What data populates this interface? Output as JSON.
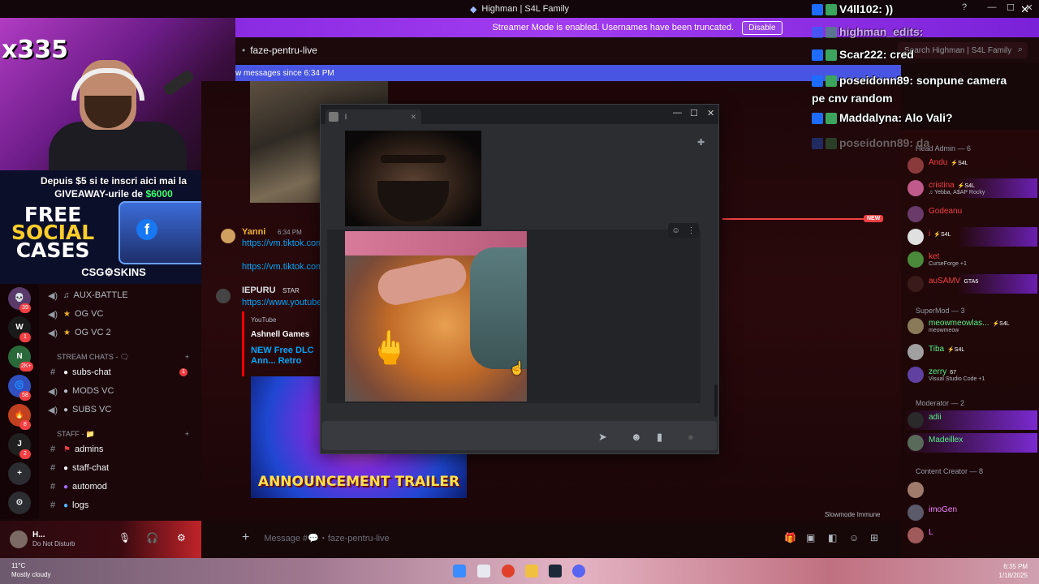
{
  "window": {
    "title": "Highman | S4L Family"
  },
  "streamer_bar": {
    "text": "Streamer Mode is enabled. Usernames have been truncated.",
    "button": "Disable"
  },
  "channel_header": {
    "name": "faze-pentru-live",
    "search_placeholder": "Search Highman | S4L Family"
  },
  "new_messages": {
    "text": "w messages since 6:34 PM"
  },
  "webcam": {
    "counter": "x335"
  },
  "promo": {
    "line1": "Depuis $5 si te inscri aici mai la",
    "line2_prefix": "GIVEAWAY-urile de ",
    "line2_amount": "$6000",
    "free": "FREE",
    "social": "SOCIAL",
    "cases": "CASES",
    "brand": "CSG⚙SKINS"
  },
  "servers": [
    {
      "label": "💀",
      "color": "#5a3a6a",
      "badge": "39"
    },
    {
      "label": "W",
      "color": "#1a1a1a",
      "badge": "1"
    },
    {
      "label": "N",
      "color": "#2a6a3a",
      "badge": "2K+"
    },
    {
      "label": "🌀",
      "color": "#3050c0",
      "badge": "58"
    },
    {
      "label": "🔥",
      "color": "#c04020",
      "badge": "8"
    },
    {
      "label": "J",
      "color": "#202020",
      "badge": "2"
    },
    {
      "label": "+",
      "color": "#2b2d31",
      "badge": ""
    },
    {
      "label": "⊙",
      "color": "#2b2d31",
      "badge": ""
    }
  ],
  "channels": {
    "aux_battle": "AUX-BATTLE",
    "og_vc": "OG VC",
    "og_vc_2": "OG VC 2",
    "stream_chats_cat": "STREAM CHATS - 🗨",
    "subs_chat": "subs-chat",
    "subs_chat_badge": "1",
    "mods_vc": "MODS VC",
    "subs_vc": "SUBS VC",
    "staff_cat": "STAFF - 📁",
    "admins": "admins",
    "staff_chat": "staff-chat",
    "automod": "automod",
    "logs": "logs"
  },
  "user_panel": {
    "name": "H...",
    "status": "Do Not Disturb"
  },
  "chat": {
    "msg1_name": "Yanni",
    "msg1_time": "6:34 PM",
    "msg1_link1": "https://vm.tiktok.com",
    "msg1_link2": "https://vm.tiktok.com",
    "msg2_name": "IEPURU",
    "msg2_tag": "STAR",
    "msg2_link": "https://www.youtube",
    "embed_provider": "YouTube",
    "embed_author": "Ashnell Games",
    "embed_title": "NEW Free DLC Ann... Retro",
    "trailer_text": "ANNOUNCEMENT TRAILER",
    "new_tag": "NEW",
    "composer_placeholder": "Message #💬・faze-pentru-live",
    "slowmode": "Slowmode Immune"
  },
  "popup": {
    "tab_title": "l"
  },
  "members": {
    "head_admin": "Head Admin — 6",
    "supermod": "SuperMod — 3",
    "moderator": "Moderator — 2",
    "content_creator": "Content Creator — 8",
    "rows": [
      {
        "name": "Andu",
        "tag": "⚡S4L",
        "sub": "",
        "color": "#f23f43"
      },
      {
        "name": "cristina",
        "tag": "⚡S4L",
        "sub": "♫ Yebba, A$AP Rocky",
        "color": "#f23f43"
      },
      {
        "name": "Godeanu",
        "tag": "",
        "sub": "",
        "color": "#f23f43"
      },
      {
        "name": "i",
        "tag": "⚡S4L",
        "sub": "",
        "color": "#f23f43"
      },
      {
        "name": "ket",
        "tag": "",
        "sub": "CurseForge +1",
        "color": "#f23f43"
      },
      {
        "name": "auSAMV",
        "tag": "GTA6",
        "sub": "",
        "color": "#f23f43"
      },
      {
        "name": "meowmeowlas...",
        "tag": "⚡S4L",
        "sub": "meowmeow",
        "color": "#57f287"
      },
      {
        "name": "Tiba",
        "tag": "⚡S4L",
        "sub": "",
        "color": "#57f287"
      },
      {
        "name": "zerry",
        "tag": "67",
        "sub": "Visual Studio Code +1",
        "color": "#57f287"
      },
      {
        "name": "adii",
        "tag": "",
        "sub": "",
        "color": "#57f287"
      },
      {
        "name": "Madeillex",
        "tag": "",
        "sub": "",
        "color": "#57f287"
      },
      {
        "name": "",
        "tag": "",
        "sub": "",
        "color": "#f47fff"
      },
      {
        "name": "imoGen",
        "tag": "",
        "sub": "",
        "color": "#f47fff"
      },
      {
        "name": "L",
        "tag": "",
        "sub": "",
        "color": "#f47fff"
      }
    ]
  },
  "overlay_chat": [
    {
      "text": "V4ll102: ))"
    },
    {
      "text": "highman_edits:"
    },
    {
      "text": "Scar222: cred"
    },
    {
      "text": "poseidonn89: sonpune camera pe cnv random"
    },
    {
      "text": "Maddalyna: Alo Vali?"
    },
    {
      "text": "poseidonn89: da"
    }
  ],
  "taskbar": {
    "temp": "11°C",
    "weather": "Mostly cloudy",
    "time": "6:35 PM",
    "date": "1/18/2025"
  }
}
